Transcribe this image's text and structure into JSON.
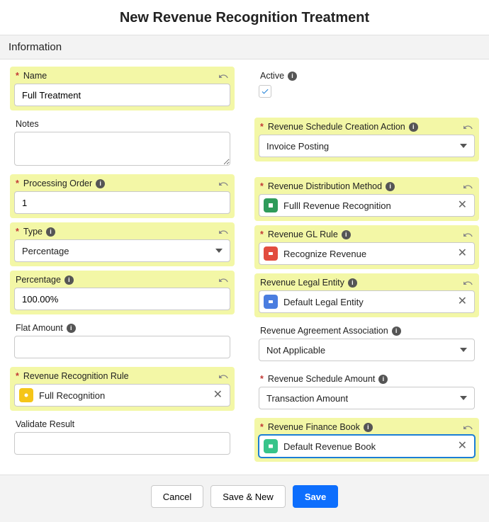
{
  "page_title": "New Revenue Recognition Treatment",
  "section": "Information",
  "left": {
    "name": {
      "label": "Name",
      "value": "Full Treatment",
      "required": true,
      "highlighted": true,
      "undo": true
    },
    "notes": {
      "label": "Notes",
      "value": ""
    },
    "processing_order": {
      "label": "Processing Order",
      "value": "1",
      "required": true,
      "highlighted": true,
      "undo": true
    },
    "type": {
      "label": "Type",
      "value": "Percentage",
      "required": true,
      "highlighted": true,
      "undo": true
    },
    "percentage": {
      "label": "Percentage",
      "value": "100.00%",
      "highlighted": true,
      "undo": true
    },
    "flat_amount": {
      "label": "Flat Amount",
      "value": ""
    },
    "rev_rec_rule": {
      "label": "Revenue Recognition Rule",
      "value": "Full Recognition",
      "required": true,
      "highlighted": true,
      "undo": true
    },
    "validate_result": {
      "label": "Validate Result",
      "value": ""
    }
  },
  "right": {
    "active": {
      "label": "Active",
      "checked": true
    },
    "schedule_action": {
      "label": "Revenue Schedule Creation Action",
      "value": "Invoice Posting",
      "required": true,
      "highlighted": true,
      "undo": true
    },
    "dist_method": {
      "label": "Revenue Distribution Method",
      "value": "Fulll Revenue Recognition",
      "required": true,
      "highlighted": true,
      "undo": true
    },
    "gl_rule": {
      "label": "Revenue GL Rule",
      "value": "Recognize Revenue",
      "required": true,
      "highlighted": true,
      "undo": true
    },
    "legal_entity": {
      "label": "Revenue Legal Entity",
      "value": "Default Legal Entity",
      "highlighted": true,
      "undo": true
    },
    "agreement_assoc": {
      "label": "Revenue Agreement Association",
      "value": "Not Applicable"
    },
    "schedule_amount": {
      "label": "Revenue Schedule Amount",
      "value": "Transaction Amount",
      "required": true
    },
    "finance_book": {
      "label": "Revenue Finance Book",
      "value": "Default Revenue Book",
      "required": true,
      "highlighted": true,
      "undo": true
    }
  },
  "footer": {
    "cancel": "Cancel",
    "save_new": "Save & New",
    "save": "Save"
  }
}
